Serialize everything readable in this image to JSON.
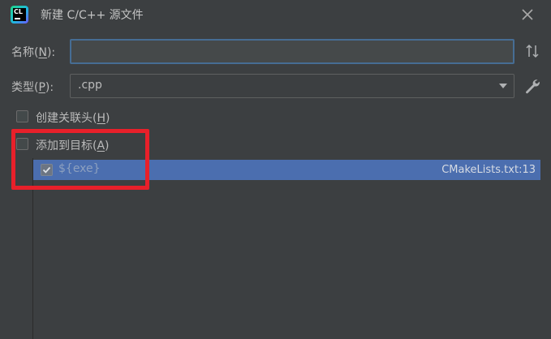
{
  "dialog": {
    "title": "新建 C/C++ 源文件",
    "icon": "clion-logo-icon",
    "icon_text": "CL"
  },
  "name_field": {
    "label": "名称(",
    "mnemonic": "N",
    "label_end": "):",
    "value": "",
    "placeholder": ""
  },
  "type_field": {
    "label": "类型(",
    "mnemonic": "P",
    "label_end": "):",
    "selected": ".cpp"
  },
  "create_header": {
    "label": "创建关联头(",
    "mnemonic": "H",
    "label_end": ")",
    "checked": false
  },
  "add_to_target": {
    "label": "添加到目标(",
    "mnemonic": "A",
    "label_end": ")",
    "checked": false
  },
  "targets": [
    {
      "name": "${exe}",
      "location": "CMakeLists.txt:13",
      "checked": true,
      "selected": true
    }
  ],
  "colors": {
    "background": "#3c3f41",
    "selection": "#4b6eaf",
    "focus_border": "#466d94",
    "highlight_annotation": "#e8202a"
  }
}
